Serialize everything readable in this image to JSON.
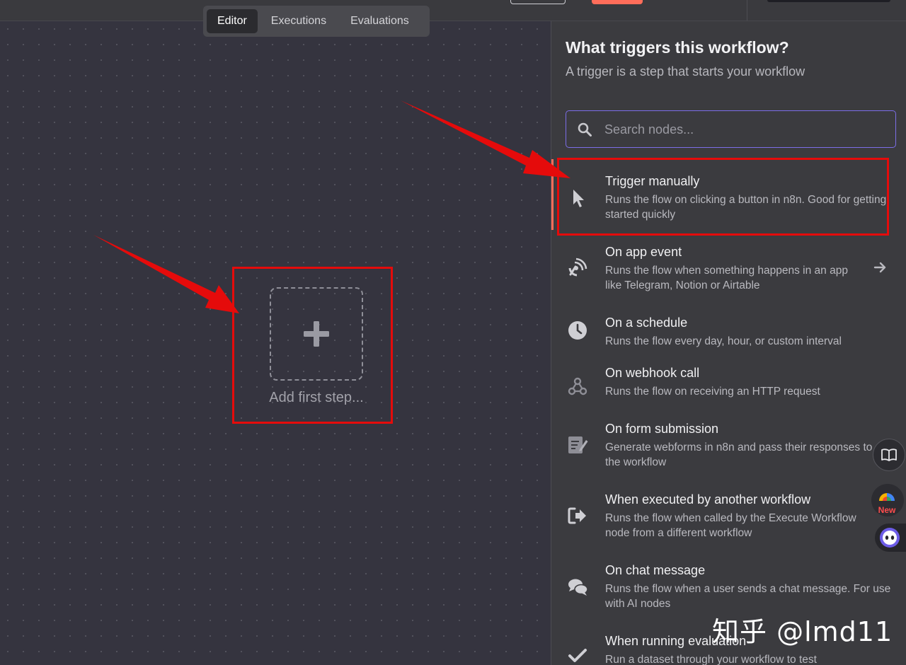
{
  "tabs": [
    {
      "label": "Editor",
      "active": true
    },
    {
      "label": "Executions",
      "active": false
    },
    {
      "label": "Evaluations",
      "active": false
    }
  ],
  "canvas": {
    "add_step_label": "Add first step..."
  },
  "panel": {
    "title": "What triggers this workflow?",
    "subtitle": "A trigger is a step that starts your workflow",
    "search_placeholder": "Search nodes...",
    "triggers": [
      {
        "title": "Trigger manually",
        "description": "Runs the flow on clicking a button in n8n. Good for getting started quickly",
        "icon": "cursor-icon"
      },
      {
        "title": "On app event",
        "description": "Runs the flow when something happens in an app like Telegram, Notion or Airtable",
        "icon": "satellite-icon"
      },
      {
        "title": "On a schedule",
        "description": "Runs the flow every day, hour, or custom interval",
        "icon": "clock-icon"
      },
      {
        "title": "On webhook call",
        "description": "Runs the flow on receiving an HTTP request",
        "icon": "webhook-icon"
      },
      {
        "title": "On form submission",
        "description": "Generate webforms in n8n and pass their responses to the workflow",
        "icon": "form-icon"
      },
      {
        "title": "When executed by another workflow",
        "description": "Runs the flow when called by the Execute Workflow node from a different workflow",
        "icon": "sign-in-icon"
      },
      {
        "title": "On chat message",
        "description": "Runs the flow when a user sends a chat message. For use with AI nodes",
        "icon": "chat-icon"
      },
      {
        "title": "When running evaluation",
        "description": "Run a dataset through your workflow to test",
        "icon": "check-icon"
      }
    ]
  },
  "widgets": {
    "new_badge": "New"
  },
  "watermark": "知乎 @lmd11",
  "colors": {
    "accent": "#ff6d5a",
    "focus": "#7c6ee8",
    "annotation": "#e50b0b"
  }
}
